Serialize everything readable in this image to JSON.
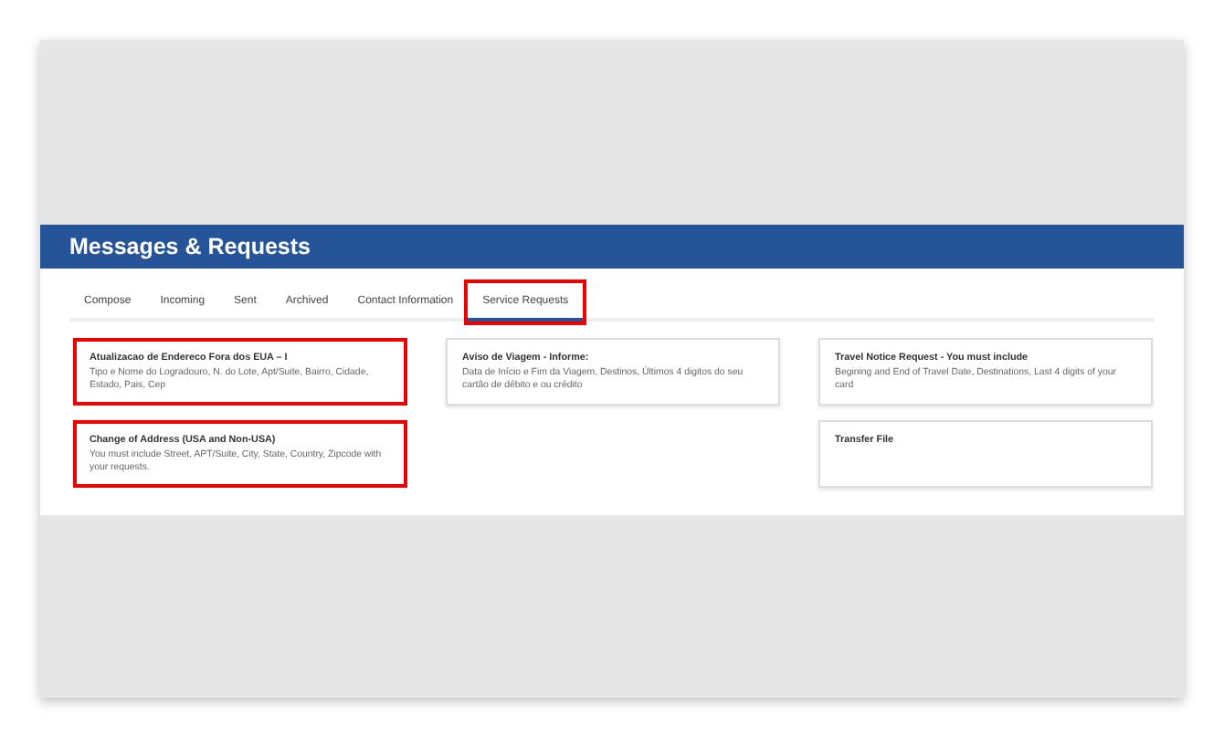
{
  "header": {
    "title": "Messages & Requests"
  },
  "tabs": [
    {
      "label": "Compose",
      "selected": false,
      "highlighted": false
    },
    {
      "label": "Incoming",
      "selected": false,
      "highlighted": false
    },
    {
      "label": "Sent",
      "selected": false,
      "highlighted": false
    },
    {
      "label": "Archived",
      "selected": false,
      "highlighted": false
    },
    {
      "label": "Contact Information",
      "selected": false,
      "highlighted": false
    },
    {
      "label": "Service Requests",
      "selected": true,
      "highlighted": true
    }
  ],
  "card_columns": [
    [
      {
        "title": "Atualizacao de Endereco Fora dos EUA – I",
        "description": "Tipo e Nome do Logradouro, N. do Lote, Apt/Suite, Bairro, Cidade, Estado, Pais, Cep",
        "highlighted": true
      },
      {
        "title": "Change of Address (USA and Non-USA)",
        "description": "You must include Street, APT/Suite, City, State, Country, Zipcode with your requests.",
        "highlighted": true
      }
    ],
    [
      {
        "title": "Aviso de Viagem - Informe:",
        "description": "Data de Início e Fim da Viagem, Destinos, Últimos 4 digitos do seu cartão de débito e ou crédito",
        "highlighted": false
      }
    ],
    [
      {
        "title": "Travel Notice Request - You must include",
        "description": "Begining and End of Travel Date, Destinations, Last 4 digits of your card",
        "highlighted": false
      },
      {
        "title": "Transfer File",
        "highlighted": false
      }
    ]
  ]
}
